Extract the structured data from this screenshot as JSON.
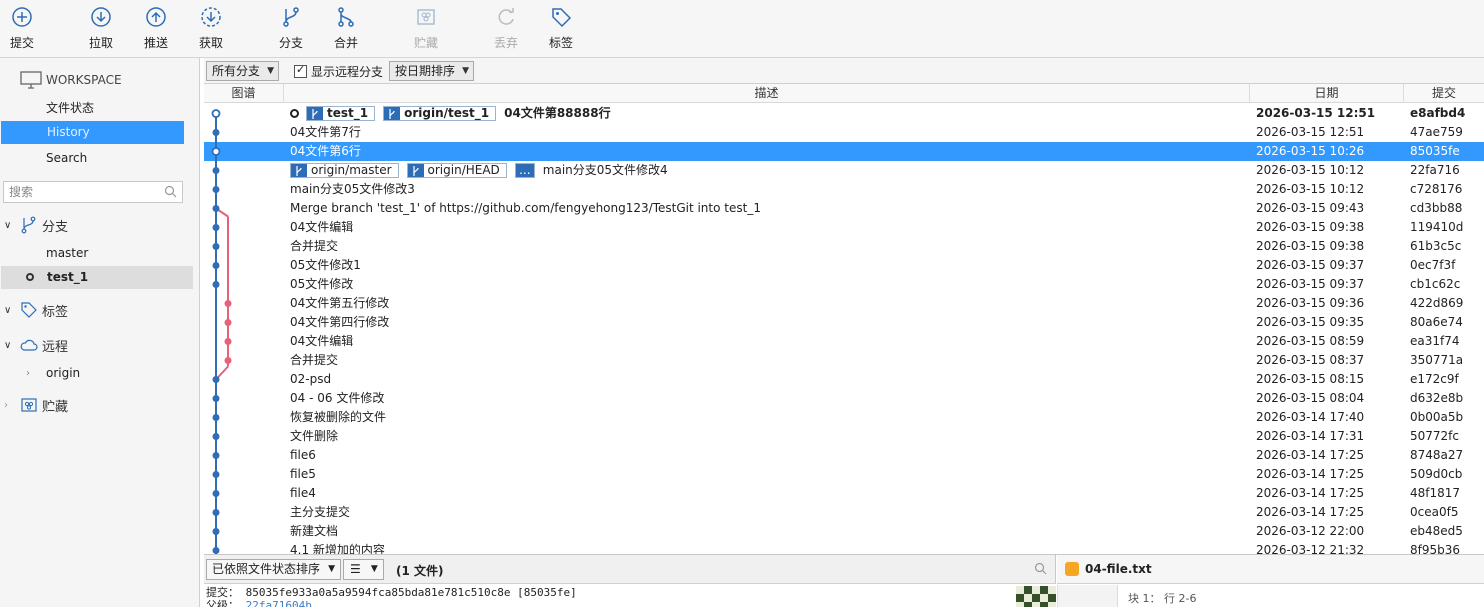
{
  "toolbar": [
    {
      "name": "commit-button",
      "icon": "plus-circle-icon",
      "label": "提交",
      "enabled": true
    },
    {
      "name": "pull-button",
      "icon": "arrow-down-circle-icon",
      "label": "拉取",
      "enabled": true
    },
    {
      "name": "push-button",
      "icon": "arrow-up-circle-icon",
      "label": "推送",
      "enabled": true
    },
    {
      "name": "fetch-button",
      "icon": "dashed-arrow-down-circle-icon",
      "label": "获取",
      "enabled": true
    },
    {
      "name": "branch-button",
      "icon": "branch-icon",
      "label": "分支",
      "enabled": true
    },
    {
      "name": "merge-button",
      "icon": "merge-icon",
      "label": "合并",
      "enabled": true
    },
    {
      "name": "stash-button",
      "icon": "stash-icon",
      "label": "贮藏",
      "enabled": false
    },
    {
      "name": "discard-button",
      "icon": "discard-icon",
      "label": "丢弃",
      "enabled": false
    },
    {
      "name": "tag-button",
      "icon": "tag-icon",
      "label": "标签",
      "enabled": true
    }
  ],
  "sidebar": {
    "workspace_label": "WORKSPACE",
    "workspace_items": [
      "文件状态",
      "History",
      "Search"
    ],
    "selected_item": "History",
    "search_placeholder": "搜索",
    "branches_label": "分支",
    "branches": [
      "master",
      "test_1"
    ],
    "current_branch": "test_1",
    "tags_label": "标签",
    "remotes_label": "远程",
    "remotes": [
      "origin"
    ],
    "stash_label": "贮藏"
  },
  "filterbar": {
    "branch_filter": "所有分支",
    "show_remote_label": "显示远程分支",
    "show_remote_checked": true,
    "sort_label": "按日期排序"
  },
  "columns": {
    "graph": "图谱",
    "description": "描述",
    "date": "日期",
    "commit": "提交"
  },
  "commits": [
    {
      "message": "04文件第88888行",
      "date": "2026-03-15 12:51",
      "hash": "e8afbd4",
      "refs": [
        "test_1",
        "origin/test_1"
      ],
      "head": true
    },
    {
      "message": "04文件第7行",
      "date": "2026-03-15 12:51",
      "hash": "47ae759"
    },
    {
      "message": "04文件第6行",
      "date": "2026-03-15 10:26",
      "hash": "85035fe",
      "selected": true
    },
    {
      "message": "main分支05文件修改4",
      "date": "2026-03-15 10:12",
      "hash": "22fa716",
      "refs": [
        "origin/master",
        "origin/HEAD"
      ],
      "more_refs": "..."
    },
    {
      "message": "main分支05文件修改3",
      "date": "2026-03-15 10:12",
      "hash": "c728176"
    },
    {
      "message": "Merge branch 'test_1' of https://github.com/fengyehong123/TestGit into test_1",
      "date": "2026-03-15 09:43",
      "hash": "cd3bb88"
    },
    {
      "message": "04文件编辑",
      "date": "2026-03-15 09:38",
      "hash": "119410d"
    },
    {
      "message": "合并提交",
      "date": "2026-03-15 09:38",
      "hash": "61b3c5c"
    },
    {
      "message": "05文件修改1",
      "date": "2026-03-15 09:37",
      "hash": "0ec7f3f"
    },
    {
      "message": "05文件修改",
      "date": "2026-03-15 09:37",
      "hash": "cb1c62c"
    },
    {
      "message": "04文件第五行修改",
      "date": "2026-03-15 09:36",
      "hash": "422d869"
    },
    {
      "message": "04文件第四行修改",
      "date": "2026-03-15 09:35",
      "hash": "80a6e74"
    },
    {
      "message": "04文件编辑",
      "date": "2026-03-15 08:59",
      "hash": "ea31f74"
    },
    {
      "message": "合并提交",
      "date": "2026-03-15 08:37",
      "hash": "350771a"
    },
    {
      "message": "02-psd",
      "date": "2026-03-15 08:15",
      "hash": "e172c9f"
    },
    {
      "message": "04 - 06 文件修改",
      "date": "2026-03-15 08:04",
      "hash": "d632e8b"
    },
    {
      "message": "恢复被删除的文件",
      "date": "2026-03-14 17:40",
      "hash": "0b00a5b"
    },
    {
      "message": "文件删除",
      "date": "2026-03-14 17:31",
      "hash": "50772fc"
    },
    {
      "message": "file6",
      "date": "2026-03-14 17:25",
      "hash": "8748a27"
    },
    {
      "message": "file5",
      "date": "2026-03-14 17:25",
      "hash": "509d0cb"
    },
    {
      "message": "file4",
      "date": "2026-03-14 17:25",
      "hash": "48f1817"
    },
    {
      "message": "主分支提交",
      "date": "2026-03-14 17:25",
      "hash": "0cea0f5"
    },
    {
      "message": "新建文档",
      "date": "2026-03-12 22:00",
      "hash": "eb48ed5"
    },
    {
      "message": "4.1 新增加的内容",
      "date": "2026-03-12 21:32",
      "hash": "8f95b36"
    }
  ],
  "graph_colors": {
    "main": "#2f6db5",
    "side": "#e8607a"
  },
  "bottom": {
    "sort_label": "已依照文件状态排序",
    "view_icon": "list-icon",
    "file_count": "(1 文件)",
    "commit_label": "提交：",
    "commit_full": "85035fe933a0a5a9594fca85bda81e781c510c8e [85035fe]",
    "parent_label": "父级：",
    "parent_hash": "22fa71604b",
    "file_name": "04-file.txt",
    "hunk_label": "块 1： 行 2-6"
  }
}
